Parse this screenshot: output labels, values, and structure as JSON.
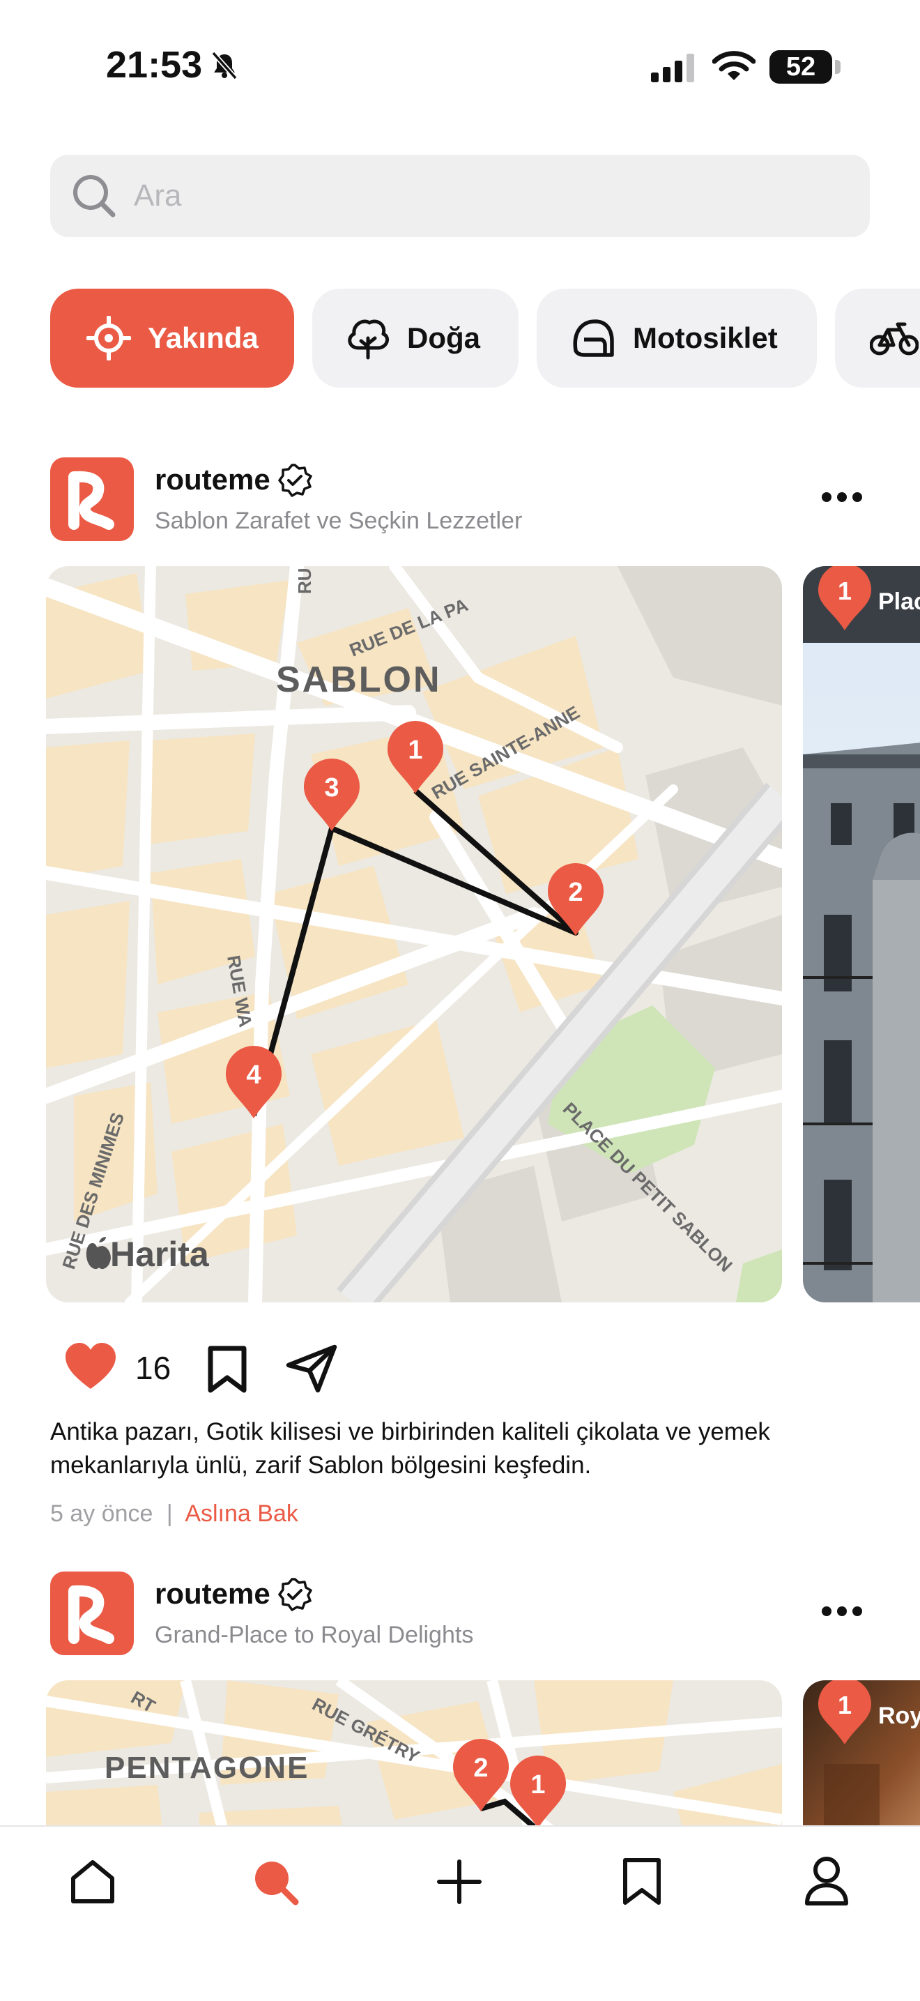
{
  "status_bar": {
    "time": "21:53",
    "battery": "52"
  },
  "search": {
    "placeholder": "Ara"
  },
  "categories": [
    {
      "label": "Yakında",
      "icon": "location-crosshair-icon",
      "active": true
    },
    {
      "label": "Doğa",
      "icon": "tree-icon",
      "active": false
    },
    {
      "label": "Motosiklet",
      "icon": "helmet-icon",
      "active": false
    }
  ],
  "posts": [
    {
      "user": "routeme",
      "subtitle": "Sablon Zarafet ve Seçkin Lezzetler",
      "map": {
        "district": "SABLON",
        "streets": [
          "RUE DE LA PA",
          "RUE SAINTE-ANNE",
          "RUE WA",
          "RUE DES MINIMES",
          "PLACE DU PETIT SABLON",
          "RU"
        ],
        "watermark": "Harita",
        "pins": [
          "1",
          "2",
          "3",
          "4"
        ]
      },
      "photo": {
        "pin": "1",
        "label": "Plac"
      },
      "likes": "16",
      "caption": "Antika pazarı, Gotik kilisesi ve birbirinden kaliteli çikolata ve yemek mekanlarıyla ünlü, zarif Sablon bölgesini keşfedin.",
      "time_ago": "5 ay önce",
      "separator": "|",
      "link": "Aslına Bak"
    },
    {
      "user": "routeme",
      "subtitle": "Grand-Place to Royal Delights",
      "map": {
        "district": "PENTAGONE",
        "streets": [
          "RUE GRÉTRY",
          "RT"
        ],
        "pins": [
          "2",
          "1"
        ]
      },
      "photo": {
        "pin": "1",
        "label": "Roy"
      }
    }
  ],
  "tabbar": [
    "home-icon",
    "search-icon",
    "add-icon",
    "bookmark-icon",
    "profile-icon"
  ],
  "colors": {
    "accent": "#ea5a45",
    "chip_bg": "#f1f1f3",
    "search_bg": "#efeff0",
    "map_block": "#f6e4c3",
    "map_bg": "#ece9e2"
  }
}
